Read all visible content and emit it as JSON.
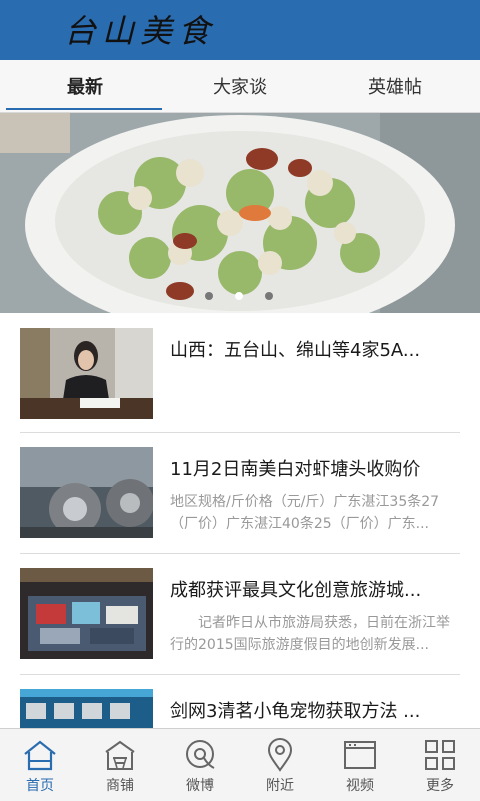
{
  "app": {
    "title": "台山美食",
    "accent_color": "#2a6cb0"
  },
  "tabs": [
    {
      "label": "最新",
      "active": true
    },
    {
      "label": "大家谈",
      "active": false
    },
    {
      "label": "英雄帖",
      "active": false
    }
  ],
  "banner": {
    "slide_index": 1,
    "slide_count": 3
  },
  "news": [
    {
      "title": "山西：五台山、绵山等4家5A...",
      "summary": ""
    },
    {
      "title": "11月2日南美白对虾塘头收购价",
      "summary": "地区规格/斤价格（元/斤）广东湛江35条27（厂价）广东湛江40条25（厂价）广东..."
    },
    {
      "title": "成都获评最具文化创意旅游城...",
      "summary": "　　记者昨日从市旅游局获悉，日前在浙江举行的2015国际旅游度假目的地创新发展..."
    },
    {
      "title": "剑网3清茗小龟宠物获取方法 ...",
      "summary": ""
    }
  ],
  "bottom_nav": [
    {
      "label": "首页",
      "icon": "home-icon",
      "active": true
    },
    {
      "label": "商铺",
      "icon": "shop-icon",
      "active": false
    },
    {
      "label": "微博",
      "icon": "weibo-icon",
      "active": false
    },
    {
      "label": "附近",
      "icon": "location-pin-icon",
      "active": false
    },
    {
      "label": "视频",
      "icon": "video-icon",
      "active": false
    },
    {
      "label": "更多",
      "icon": "grid-more-icon",
      "active": false
    }
  ]
}
